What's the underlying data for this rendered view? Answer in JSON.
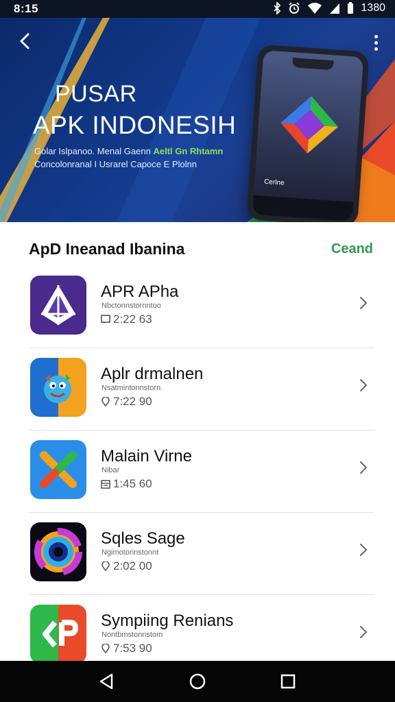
{
  "status_bar": {
    "time": "8:15",
    "battery_text": "1380",
    "icons": [
      "bluetooth-icon",
      "alarm-icon",
      "wifi-icon",
      "signal-icon",
      "battery-icon"
    ]
  },
  "hero": {
    "title_line1": "PUSAR",
    "title_line2": "APK INDONESIH",
    "subtitle_line1_prefix": "Golar Islpanoo. Menal Gaenn",
    "subtitle_line1_highlight": "Aeltl Gn Rhtamn",
    "subtitle_line2": "Concolonranal I Usrarel Capoce E Plolnn",
    "phone_label": "Cerlne",
    "accent_color": "#8ee05a"
  },
  "section": {
    "title": "ApD Ineanad Ibanina",
    "link": "Ceand",
    "link_color": "#2e9b4e"
  },
  "apps": [
    {
      "name": "APR APha",
      "subtitle": "Nbctonnstornntoo",
      "meta_icon": "review-icon",
      "meta": "2:22 63",
      "icon": "triangle-logo-icon"
    },
    {
      "name": "Aplr drmalnen",
      "subtitle": "Nsatmintonnstorn",
      "meta_icon": "location-pin-icon",
      "meta": "7:22 90",
      "icon": "cartoon-mascot-icon"
    },
    {
      "name": "Malain Virne",
      "subtitle": "Nibar",
      "meta_icon": "calendar-icon",
      "meta": "1:45 60",
      "icon": "x-cross-logo-icon"
    },
    {
      "name": "Sqles Sage",
      "subtitle": "Ngimotorinstonnt",
      "meta_icon": "location-pin-icon",
      "meta": "2:02 00",
      "icon": "color-ring-icon"
    },
    {
      "name": "Sympiing Renians",
      "subtitle": "Nontbmstonnstom",
      "meta_icon": "location-pin-icon",
      "meta": "7:53 90",
      "icon": "split-logo-icon"
    }
  ],
  "nav": [
    "back-nav-icon",
    "home-nav-icon",
    "recents-nav-icon"
  ]
}
